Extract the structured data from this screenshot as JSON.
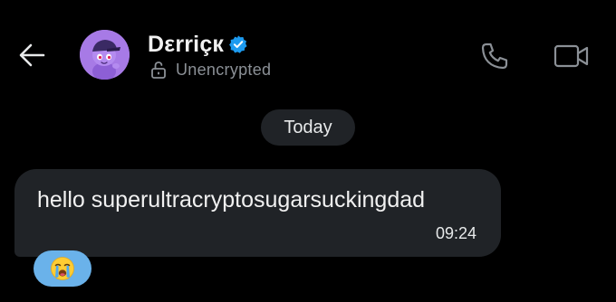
{
  "header": {
    "name": "Dεrriçк",
    "status": "Unencrypted"
  },
  "conversation": {
    "date_chip": "Today",
    "messages": [
      {
        "text": "hello superultracryptosugarsuckingdad",
        "time": "09:24",
        "reaction": "loudly-crying-face"
      }
    ]
  },
  "icons": {
    "back": "arrow-left-icon",
    "verified": "verified-badge-icon",
    "lock": "unlocked-padlock-icon",
    "call": "phone-icon",
    "video": "video-camera-icon",
    "reaction": "loudly-crying-face-emoji"
  },
  "colors": {
    "background": "#000000",
    "bubble": "#202327",
    "verified": "#1d9bf0",
    "reaction_bg": "#6ab2ea",
    "avatar_bg": "#a77ae6",
    "muted_text": "#8b9096"
  }
}
